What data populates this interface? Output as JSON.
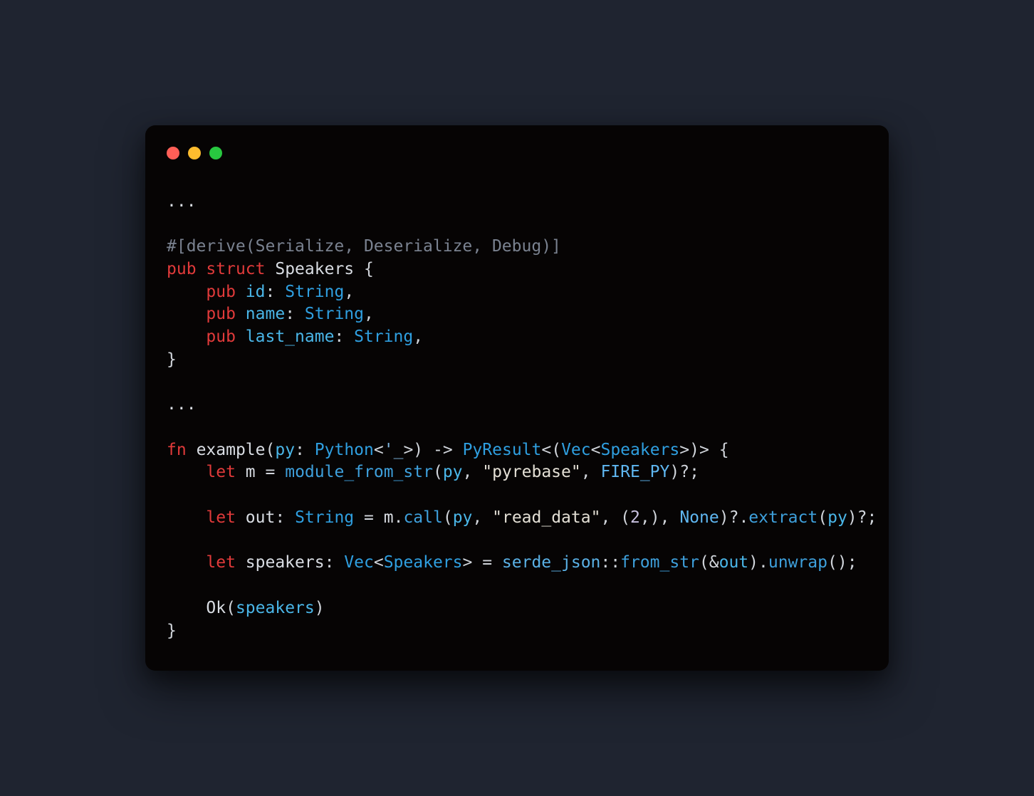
{
  "colors": {
    "bg": "#1f2430",
    "window": "#060404",
    "traffic_red": "#ff5f57",
    "traffic_yellow": "#febc2e",
    "traffic_green": "#28c840"
  },
  "tokens": {
    "ellipsis1": "...",
    "derive_line": "#[derive(Serialize, Deserialize, Debug)]",
    "pub": "pub",
    "struct": "struct",
    "speakers_type": "Speakers",
    "lbrace": "{",
    "rbrace": "}",
    "id_field": "id",
    "name_field": "name",
    "lastname_field": "last_name",
    "string_type": "String",
    "colon": ":",
    "comma": ",",
    "ellipsis2": "...",
    "fn": "fn",
    "example": "example",
    "lparen": "(",
    "rparen": ")",
    "py_param": "py",
    "python_type": "Python",
    "lt": "<",
    "gt": ">",
    "lifetime": "'_",
    "arrow": "->",
    "pyresult_type": "PyResult",
    "vec_type": "Vec",
    "let": "let",
    "m_var": "m",
    "eq": "=",
    "module_from_str_fn": "module_from_str",
    "pyrebase_str": "\"pyrebase\"",
    "fire_py_const": "FIRE_PY",
    "qmark": "?",
    "semi": ";",
    "out_var": "out",
    "dot": ".",
    "call_fn": "call",
    "read_data_str": "\"read_data\"",
    "two_lit": "2",
    "none_const": "None",
    "extract_fn": "extract",
    "speakers_var": "speakers",
    "serde_json_path": "serde_json",
    "dcolon": "::",
    "from_str_fn": "from_str",
    "amp": "&",
    "unwrap_fn": "unwrap",
    "ok_variant": "Ok"
  }
}
